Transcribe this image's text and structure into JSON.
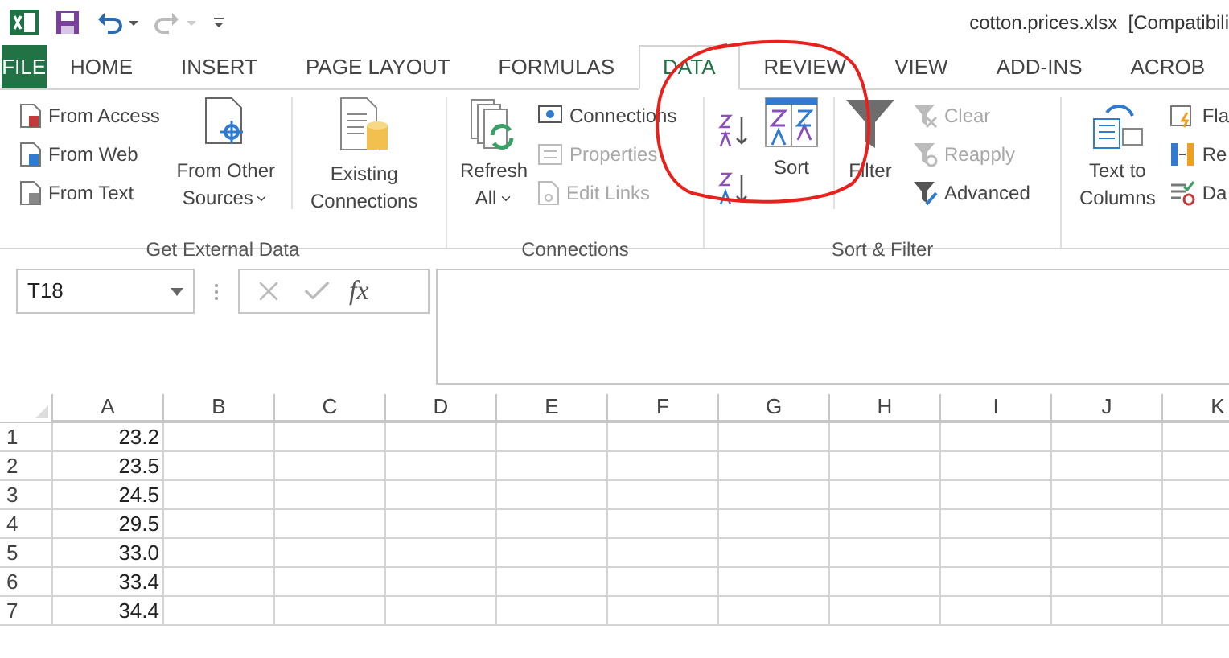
{
  "title_bar": {
    "document_title": "cotton.prices.xlsx  [Compatibili"
  },
  "tabs": [
    {
      "label": "FILE",
      "selected": false,
      "kind": "file"
    },
    {
      "label": "HOME",
      "selected": false,
      "kind": "tab"
    },
    {
      "label": "INSERT",
      "selected": false,
      "kind": "tab"
    },
    {
      "label": "PAGE LAYOUT",
      "selected": false,
      "kind": "tab"
    },
    {
      "label": "FORMULAS",
      "selected": false,
      "kind": "tab"
    },
    {
      "label": "DATA",
      "selected": true,
      "kind": "tab"
    },
    {
      "label": "REVIEW",
      "selected": false,
      "kind": "tab"
    },
    {
      "label": "VIEW",
      "selected": false,
      "kind": "tab"
    },
    {
      "label": "ADD-INS",
      "selected": false,
      "kind": "tab"
    },
    {
      "label": "ACROB",
      "selected": false,
      "kind": "tab"
    }
  ],
  "ribbon": {
    "groups": [
      {
        "label": "Get External Data",
        "items": [
          {
            "label": "From Access",
            "disabled": false
          },
          {
            "label": "From Web",
            "disabled": false
          },
          {
            "label": "From Text",
            "disabled": false
          },
          {
            "label": "From Other Sources",
            "disabled": false
          },
          {
            "label": "Existing Connections",
            "disabled": false
          }
        ]
      },
      {
        "label": "Connections",
        "items": [
          {
            "label": "Refresh All",
            "disabled": false
          },
          {
            "label": "Connections",
            "disabled": false
          },
          {
            "label": "Properties",
            "disabled": true
          },
          {
            "label": "Edit Links",
            "disabled": true
          }
        ]
      },
      {
        "label": "Sort & Filter",
        "items": [
          {
            "label": "Sort",
            "disabled": false
          },
          {
            "label": "Filter",
            "disabled": false
          },
          {
            "label": "Clear",
            "disabled": true
          },
          {
            "label": "Reapply",
            "disabled": true
          },
          {
            "label": "Advanced",
            "disabled": false
          }
        ]
      },
      {
        "items": [
          {
            "label": "Text to Columns",
            "disabled": false
          },
          {
            "label": "Fla",
            "disabled": false
          },
          {
            "label": "Re",
            "disabled": false
          },
          {
            "label": "Da",
            "disabled": false
          }
        ]
      }
    ]
  },
  "formula_bar": {
    "name_box": "T18",
    "function_button": "fx"
  },
  "sheet": {
    "columns": [
      "A",
      "B",
      "C",
      "D",
      "E",
      "F",
      "G",
      "H",
      "I",
      "J",
      "K"
    ],
    "rows": [
      {
        "header": "1",
        "a": "23.2"
      },
      {
        "header": "2",
        "a": "23.5"
      },
      {
        "header": "3",
        "a": "24.5"
      },
      {
        "header": "4",
        "a": "29.5"
      },
      {
        "header": "5",
        "a": "33.0"
      },
      {
        "header": "6",
        "a": "33.4"
      },
      {
        "header": "7",
        "a": "34.4"
      }
    ]
  }
}
